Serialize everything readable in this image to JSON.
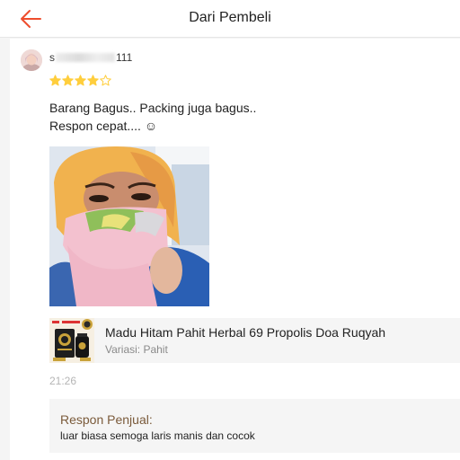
{
  "header": {
    "title": "Dari Pembeli",
    "back_icon": "arrow-left-icon",
    "accent_color": "#ee4d2d"
  },
  "review": {
    "username_prefix": "s",
    "username_suffix": "111",
    "rating": 4,
    "rating_max": 5,
    "star_color": "#ffce3d",
    "lines": [
      "Barang Bagus.. Packing juga bagus..",
      "Respon cepat.... ☺"
    ],
    "timestamp": "21:26"
  },
  "product": {
    "name": "Madu Hitam Pahit Herbal 69 Propolis Doa Ruqyah",
    "variant": "Variasi: Pahit"
  },
  "seller_reply": {
    "label": "Respon Penjual:",
    "text": "luar biasa semoga laris manis dan cocok"
  }
}
